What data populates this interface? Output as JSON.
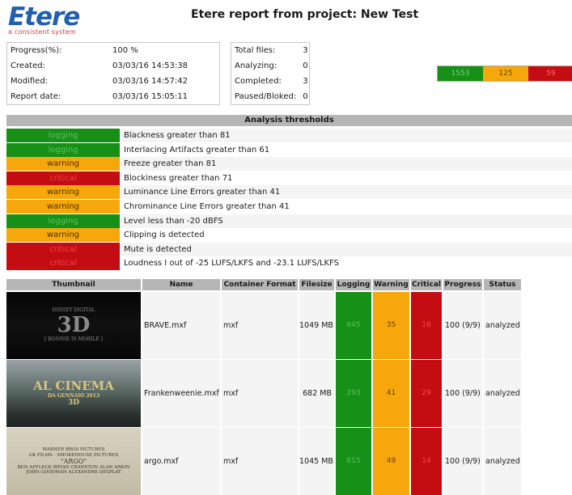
{
  "logo": {
    "word": "Etere",
    "tagline": "a consistent system"
  },
  "report_title": "Etere report from project: New Test",
  "info": [
    {
      "label": "Progress(%):",
      "value": "100 %"
    },
    {
      "label": "Created:",
      "value": "03/03/16 14:53:38"
    },
    {
      "label": "Modified:",
      "value": "03/03/16 14:57:42"
    },
    {
      "label": "Report date:",
      "value": "03/03/16 15:05:11"
    }
  ],
  "counts": [
    {
      "label": "Total files:",
      "value": "3"
    },
    {
      "label": "Analyzing:",
      "value": "0"
    },
    {
      "label": "Completed:",
      "value": "3"
    },
    {
      "label": "Paused/Bloked:",
      "value": "0"
    }
  ],
  "summary": {
    "logging": "1553",
    "warning": "125",
    "critical": "59"
  },
  "thresholds_title": "Analysis thresholds",
  "thresholds": [
    {
      "level": "logging",
      "text": "Blackness greater than 81"
    },
    {
      "level": "logging",
      "text": "Interlacing Artifacts greater than 61"
    },
    {
      "level": "warning",
      "text": "Freeze greater than 81"
    },
    {
      "level": "critical",
      "text": "Blockiness greater than 71"
    },
    {
      "level": "warning",
      "text": "Luminance Line Errors greater than 41"
    },
    {
      "level": "warning",
      "text": "Chrominance Line Errors greater than 41"
    },
    {
      "level": "logging",
      "text": "Level less than -20 dBFS"
    },
    {
      "level": "warning",
      "text": "Clipping is detected"
    },
    {
      "level": "critical",
      "text": "Mute is detected"
    },
    {
      "level": "critical",
      "text": "Loudness I out of -25 LUFS/LKFS and -23.1 LUFS/LKFS"
    }
  ],
  "columns": [
    "Thumbnail",
    "Name",
    "Container Format",
    "Filesize",
    "Logging",
    "Warning",
    "Critical",
    "Progress",
    "Status"
  ],
  "files": [
    {
      "name": "BRAVE.mxf",
      "format": "mxf",
      "size": "1049 MB",
      "logging": "645",
      "warning": "35",
      "critical": "16",
      "progress": "100 (9/9)",
      "status": "analyzed",
      "thumb_lines": [
        "DISNEY DIGITAL",
        "3D",
        "[ RONNIE IS MOBILE ]"
      ]
    },
    {
      "name": "Frankenweenie.mxf",
      "format": "mxf",
      "size": "682 MB",
      "logging": "293",
      "warning": "41",
      "critical": "29",
      "progress": "100 (9/9)",
      "status": "analyzed",
      "thumb_lines": [
        "AL CINEMA",
        "DA GENNAIO 2013",
        "3D"
      ]
    },
    {
      "name": "argo.mxf",
      "format": "mxf",
      "size": "1045 MB",
      "logging": "615",
      "warning": "49",
      "critical": "14",
      "progress": "100 (9/9)",
      "status": "analyzed",
      "thumb_lines": [
        "WARNER BROS PICTURES",
        "GK FILMS - SMOKEHOUSE PICTURES",
        "\"ARGO\"",
        "BEN AFFLECK  BRYAN CRANSTON  ALAN ARKIN",
        "JOHN GOODMAN  ALEXANDRE DESPLAT"
      ]
    }
  ]
}
